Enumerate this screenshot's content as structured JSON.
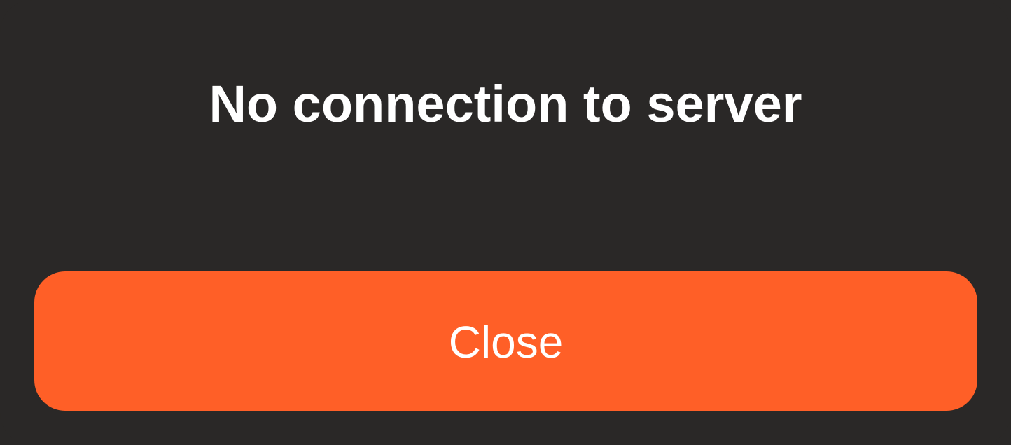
{
  "dialog": {
    "title": "No connection to server",
    "close_label": "Close"
  },
  "colors": {
    "background": "#2a2827",
    "accent": "#ff5f27",
    "text": "#ffffff"
  }
}
